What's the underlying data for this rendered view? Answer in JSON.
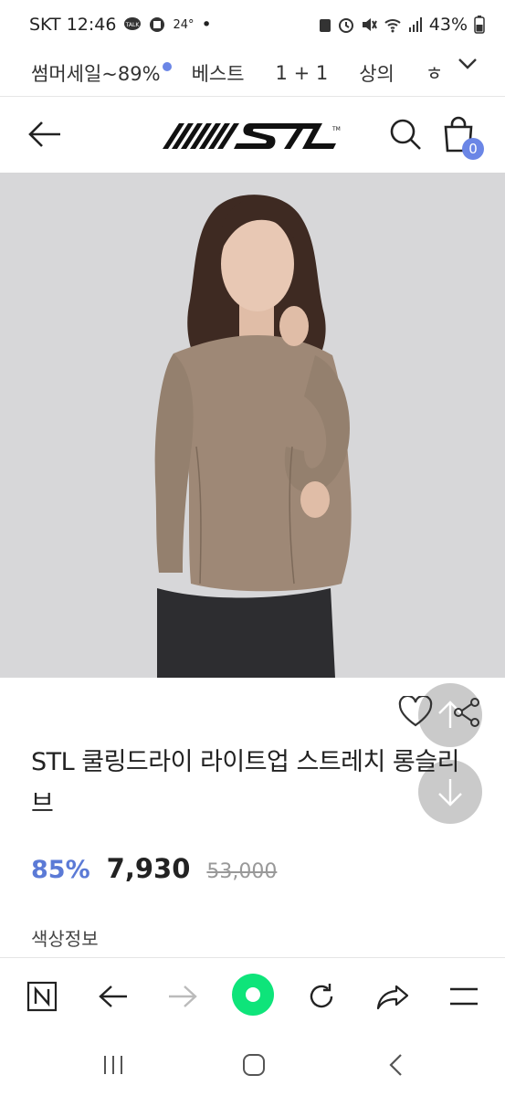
{
  "status_bar": {
    "carrier_time": "SKT 12:46",
    "temperature": "24°",
    "dot": "•",
    "battery": "43%",
    "icons": [
      "talk-icon",
      "box-icon",
      "alarm-icon",
      "mute-icon",
      "wifi-icon",
      "signal-icon",
      "battery-icon"
    ]
  },
  "category_nav": {
    "items": [
      {
        "label": "썸머세일~89%"
      },
      {
        "label": "베스트"
      },
      {
        "label": "1 + 1"
      },
      {
        "label": "상의"
      },
      {
        "label": "ㅎ"
      }
    ]
  },
  "header": {
    "logo_alt": "STL",
    "cart_count": "0"
  },
  "product": {
    "title": "STL 쿨링드라이 라이트업 스트레치 롱슬리브",
    "discount": "85%",
    "price": "7,930",
    "original_price": "53,000",
    "color_label": "색상정보",
    "image_colors": {
      "background": "#d7d7d9",
      "shirt": "#9e8876",
      "pants": "#2d2d30",
      "hair": "#3e2a22",
      "skin": "#e8c8b4"
    }
  },
  "colors": {
    "accent": "#6b86e6",
    "discount": "#5b7ad6",
    "home_green": "#0ee47a"
  }
}
